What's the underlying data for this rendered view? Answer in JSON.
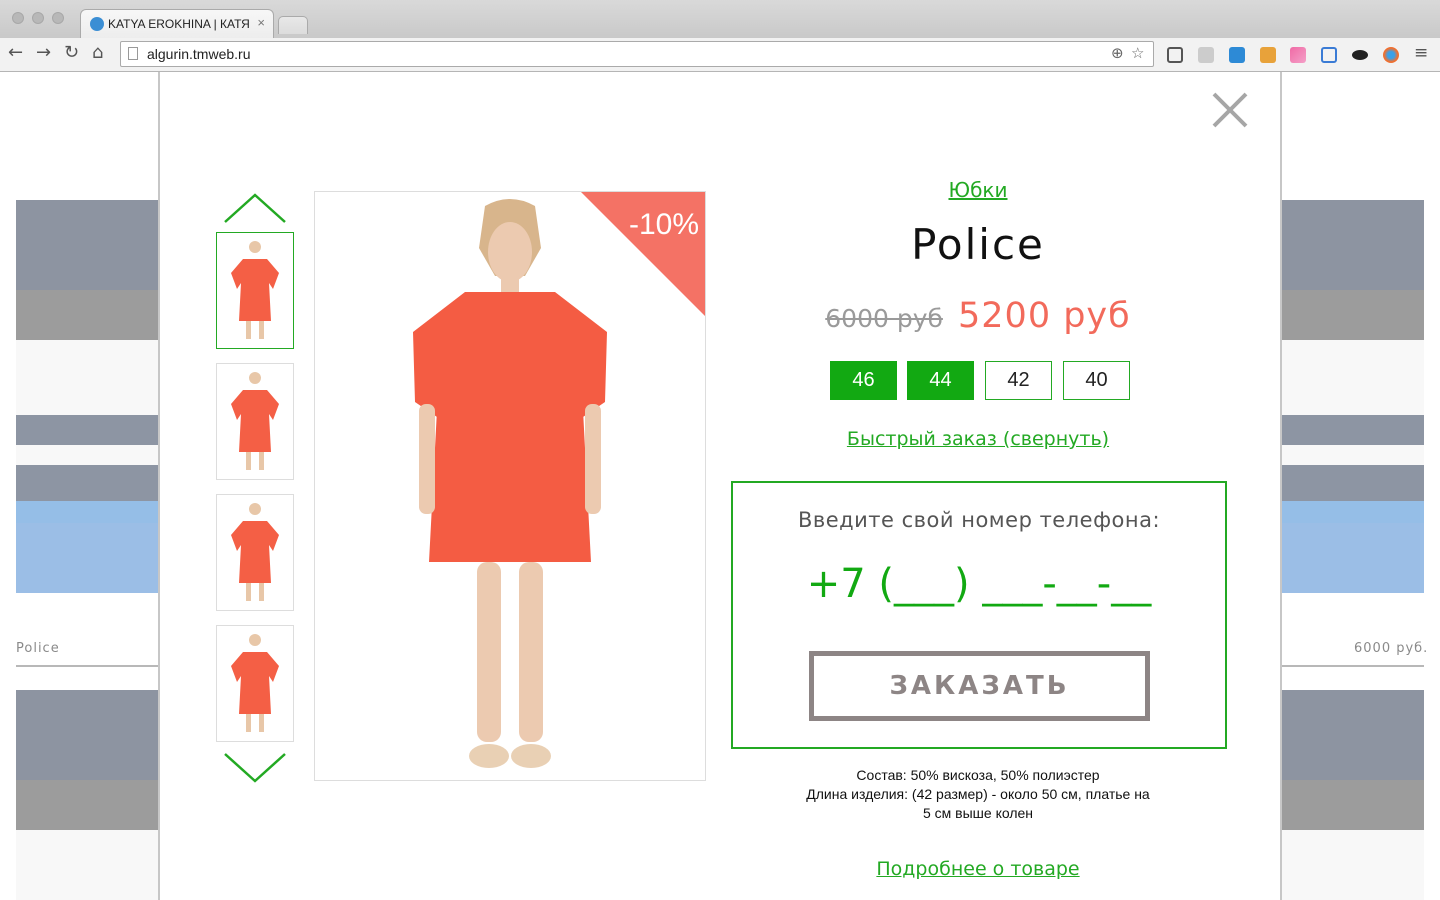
{
  "browser": {
    "tab_title": "KATYA EROKHINA | КАТЯ ЕРОХИНА",
    "tab_close": "×",
    "url": "algurin.tmweb.ru"
  },
  "background": {
    "left_caption": "Police",
    "right_caption": "6000 руб."
  },
  "modal": {
    "close_icon": "close-icon",
    "category": "Юбки",
    "title": "Police",
    "old_price": "6000 руб",
    "new_price": "5200 руб",
    "discount": "-10%",
    "sizes": [
      {
        "label": "46",
        "selected": true
      },
      {
        "label": "44",
        "selected": true
      },
      {
        "label": "42",
        "selected": false
      },
      {
        "label": "40",
        "selected": false
      }
    ],
    "quick_order_link": "Быстрый заказ (свернуть)",
    "phone_prompt": "Введите свой номер телефона:",
    "phone_mask": "+7 (___) ___-__-__",
    "order_button": "ЗАКАЗАТЬ",
    "description": {
      "line1": "Состав: 50% вискоза, 50% полиэстер",
      "line2": "Длина изделия: (42 размер) - около 50 см, платье на",
      "line3": "5 см выше колен"
    },
    "more_link": "Подробнее о товаре"
  },
  "colors": {
    "accent_green": "#23a923",
    "price_red": "#f26a5b",
    "discount_badge": "#f47265",
    "button_gray": "#8d8585"
  }
}
